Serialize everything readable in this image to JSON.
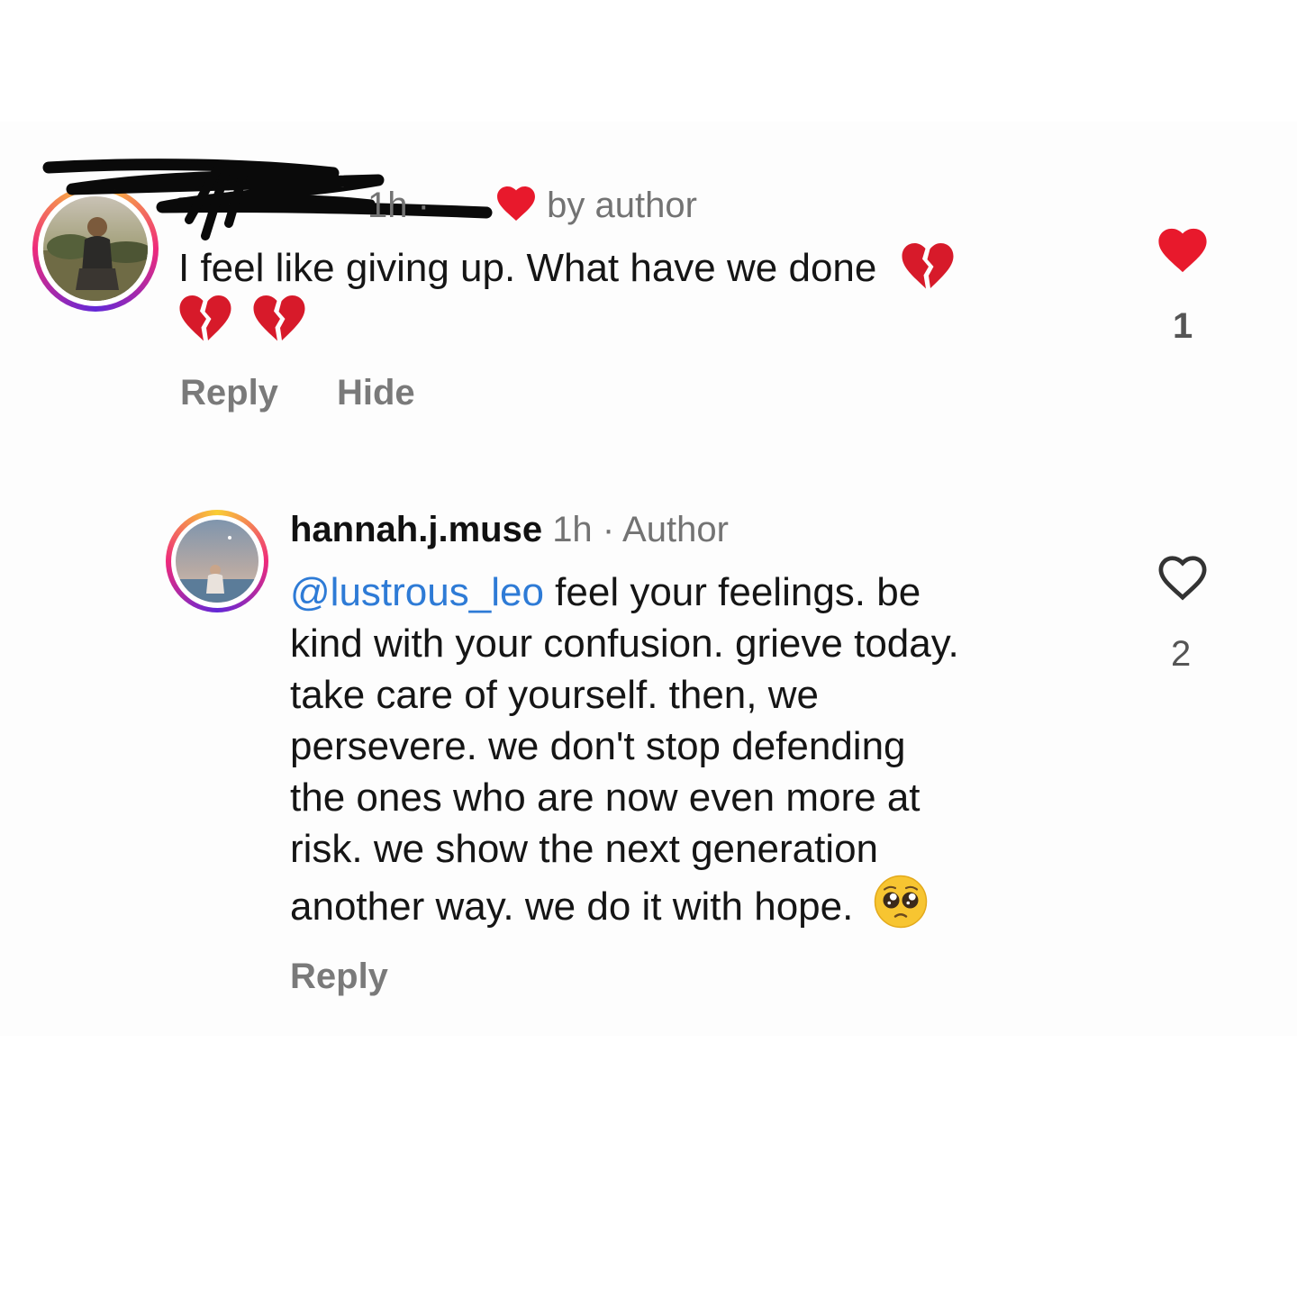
{
  "comment": {
    "time": "1h",
    "separator": "·",
    "liked_by_label": "by author",
    "text": "I feel like giving up. What have we done",
    "emojis": [
      "broken-heart",
      "broken-heart",
      "broken-heart"
    ],
    "like_count": "1",
    "liked": true,
    "actions": {
      "reply": "Reply",
      "hide": "Hide"
    }
  },
  "reply": {
    "username": "hannah.j.muse",
    "time": "1h",
    "separator": "·",
    "badge": "Author",
    "mention": "@lustrous_leo",
    "lines": [
      "feel your feelings. be",
      "kind with your confusion. grieve today.",
      "take care of yourself. then, we",
      "persevere. we don't stop defending",
      "the ones who are now even more at",
      "risk. we show the next generation",
      "another way. we do it with hope."
    ],
    "end_emoji": "pleading-face",
    "like_count": "2",
    "liked": false,
    "actions": {
      "reply": "Reply"
    }
  },
  "colors": {
    "heart_red": "#e8192c",
    "mention_blue": "#2e7bd6",
    "muted_gray": "#737373"
  }
}
